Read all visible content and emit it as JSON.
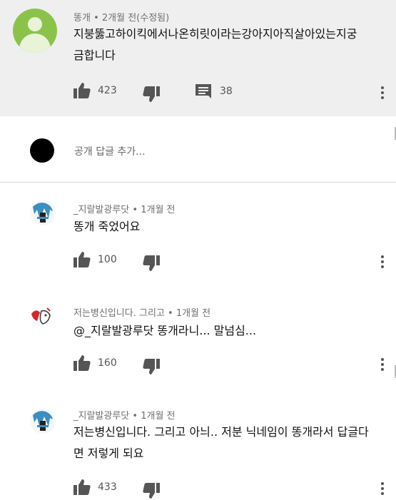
{
  "main_comment": {
    "author": "똥개",
    "meta_time": "2개월 전(수정됨)",
    "text_line1": "지붕뚫고하이킥에서나온히릿이라는강아지아직살아있는지궁",
    "text_line2": "금합니다",
    "likes": "423",
    "replies": "38"
  },
  "reply_input": {
    "placeholder": "공개 답글 추가..."
  },
  "replies": [
    {
      "author": "_지랄발광루닷",
      "meta_time": "1개월 전",
      "text_line1": "똥개 죽었어요",
      "text_line2": "",
      "likes": "100"
    },
    {
      "author": "저는병신입니다. 그리고",
      "meta_time": "1개월 전",
      "text_line1": "@_지랄발광루닷 똥개라니... 말넘심...",
      "text_line2": "",
      "likes": "160"
    },
    {
      "author": "_지랄발광루닷",
      "meta_time": "1개월 전",
      "text_line1": "저는병신입니다. 그리고 아늬.. 저분 닉네임이 똥개라서 답글다",
      "text_line2": "면 저렇게 되요",
      "likes": "433"
    }
  ],
  "separator": "•",
  "colors": {
    "highlight_bg": "#efefef",
    "avatar_green": "#8bc34a",
    "icon_gray": "#555555"
  }
}
